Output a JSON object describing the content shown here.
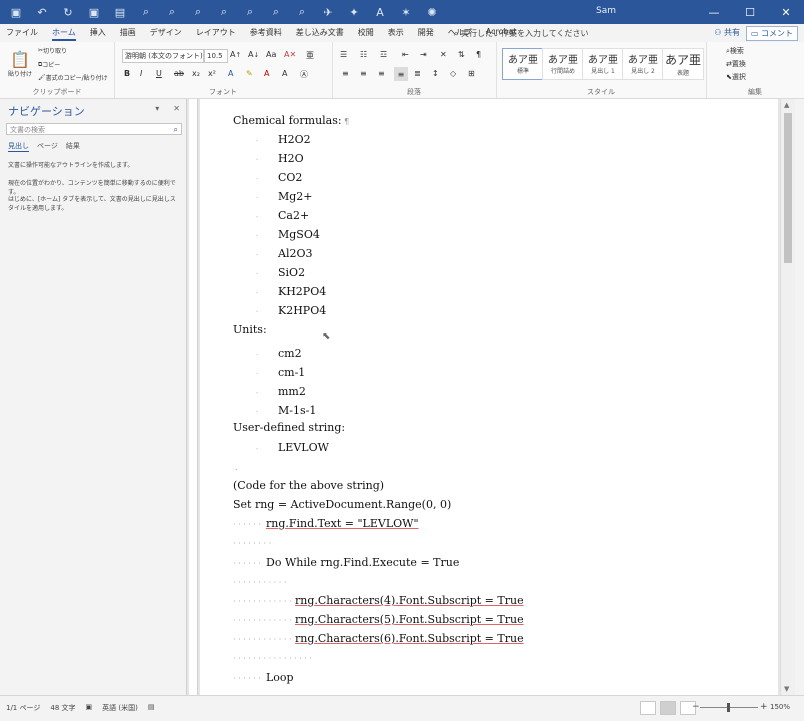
{
  "titlebar": {
    "user": "Sam",
    "qat_icons": [
      "save-icon",
      "undo-icon",
      "redo-icon",
      "save-icon",
      "new-doc-icon",
      "search-icon",
      "search-icon",
      "search-icon",
      "search-icon",
      "search-icon",
      "search-icon",
      "search-icon",
      "bird-icon",
      "star-icon",
      "text-icon",
      "star-icon",
      "gear-icon"
    ],
    "window_controls": [
      "—",
      "☐",
      "✕"
    ]
  },
  "menu": {
    "tabs": [
      "ファイル",
      "ホーム",
      "挿入",
      "描画",
      "デザイン",
      "レイアウト",
      "参考資料",
      "差し込み文書",
      "校閲",
      "表示",
      "開発",
      "ヘルプ",
      "Acrobat"
    ],
    "active_tab": "ホーム",
    "tell_me": "実行したい作業を入力してください",
    "share": "共有",
    "comment": "コメント"
  },
  "ribbon": {
    "paste_label": "貼り付け",
    "cut": "切り取り",
    "copy": "コピー",
    "format_painter": "書式のコピー/貼り付け",
    "clipboard_group": "クリップボード",
    "font_name": "游明朝 (本文のフォント)",
    "font_size": "10.5",
    "font_group": "フォント",
    "paragraph_group": "段落",
    "styles_group": "スタイル",
    "editing_group": "編集",
    "styles": [
      {
        "preview": "あア亜",
        "name": "標準"
      },
      {
        "preview": "あア亜",
        "name": "行間詰め"
      },
      {
        "preview": "あア亜",
        "name": "見出し 1"
      },
      {
        "preview": "あア亜",
        "name": "見出し 2"
      },
      {
        "preview": "あア亜",
        "name": "表題"
      }
    ],
    "find": "検索",
    "replace": "置換",
    "select": "選択"
  },
  "nav": {
    "title": "ナビゲーション",
    "search_placeholder": "文書の検索",
    "tabs": [
      "見出し",
      "ページ",
      "結果"
    ],
    "msg1": "文書に操作可能なアウトラインを作成します。",
    "msg2": "現在の位置がわかり、コンテンツを簡単に移動するのに便利です。",
    "msg3": "はじめに、[ホーム] タブを表示して、文書の見出しに見出しスタイルを適用します。"
  },
  "doc": {
    "chem_heading": "Chemical formulas:",
    "chem_items": [
      "H2O2",
      "H2O",
      "CO2",
      "Mg2+",
      "Ca2+",
      "MgSO4",
      "Al2O3",
      "SiO2",
      "KH2PO4",
      "K2HPO4"
    ],
    "units_heading": "Units:",
    "unit_items": [
      "cm2",
      "cm-1",
      "mm2",
      "M-1s-1"
    ],
    "user_heading": "User-defined string:",
    "user_items": [
      "LEVLOW"
    ],
    "code_caption": "(Code for the above string)",
    "code_line1": "Set rng = ActiveDocument.Range(0, 0)",
    "code_line2": "rng.Find.Text = \"LEVLOW\"",
    "code_line3": "Do While rng.Find.Execute = True",
    "code_line4": "rng.Characters(4).Font.Subscript = True",
    "code_line5": "rng.Characters(5).Font.Subscript = True",
    "code_line6": "rng.Characters(6).Font.Subscript = True",
    "code_line7": "Loop"
  },
  "status": {
    "page": "1/1 ページ",
    "words": "48 文字",
    "language": "英語 (米国)",
    "zoom": "150%"
  }
}
